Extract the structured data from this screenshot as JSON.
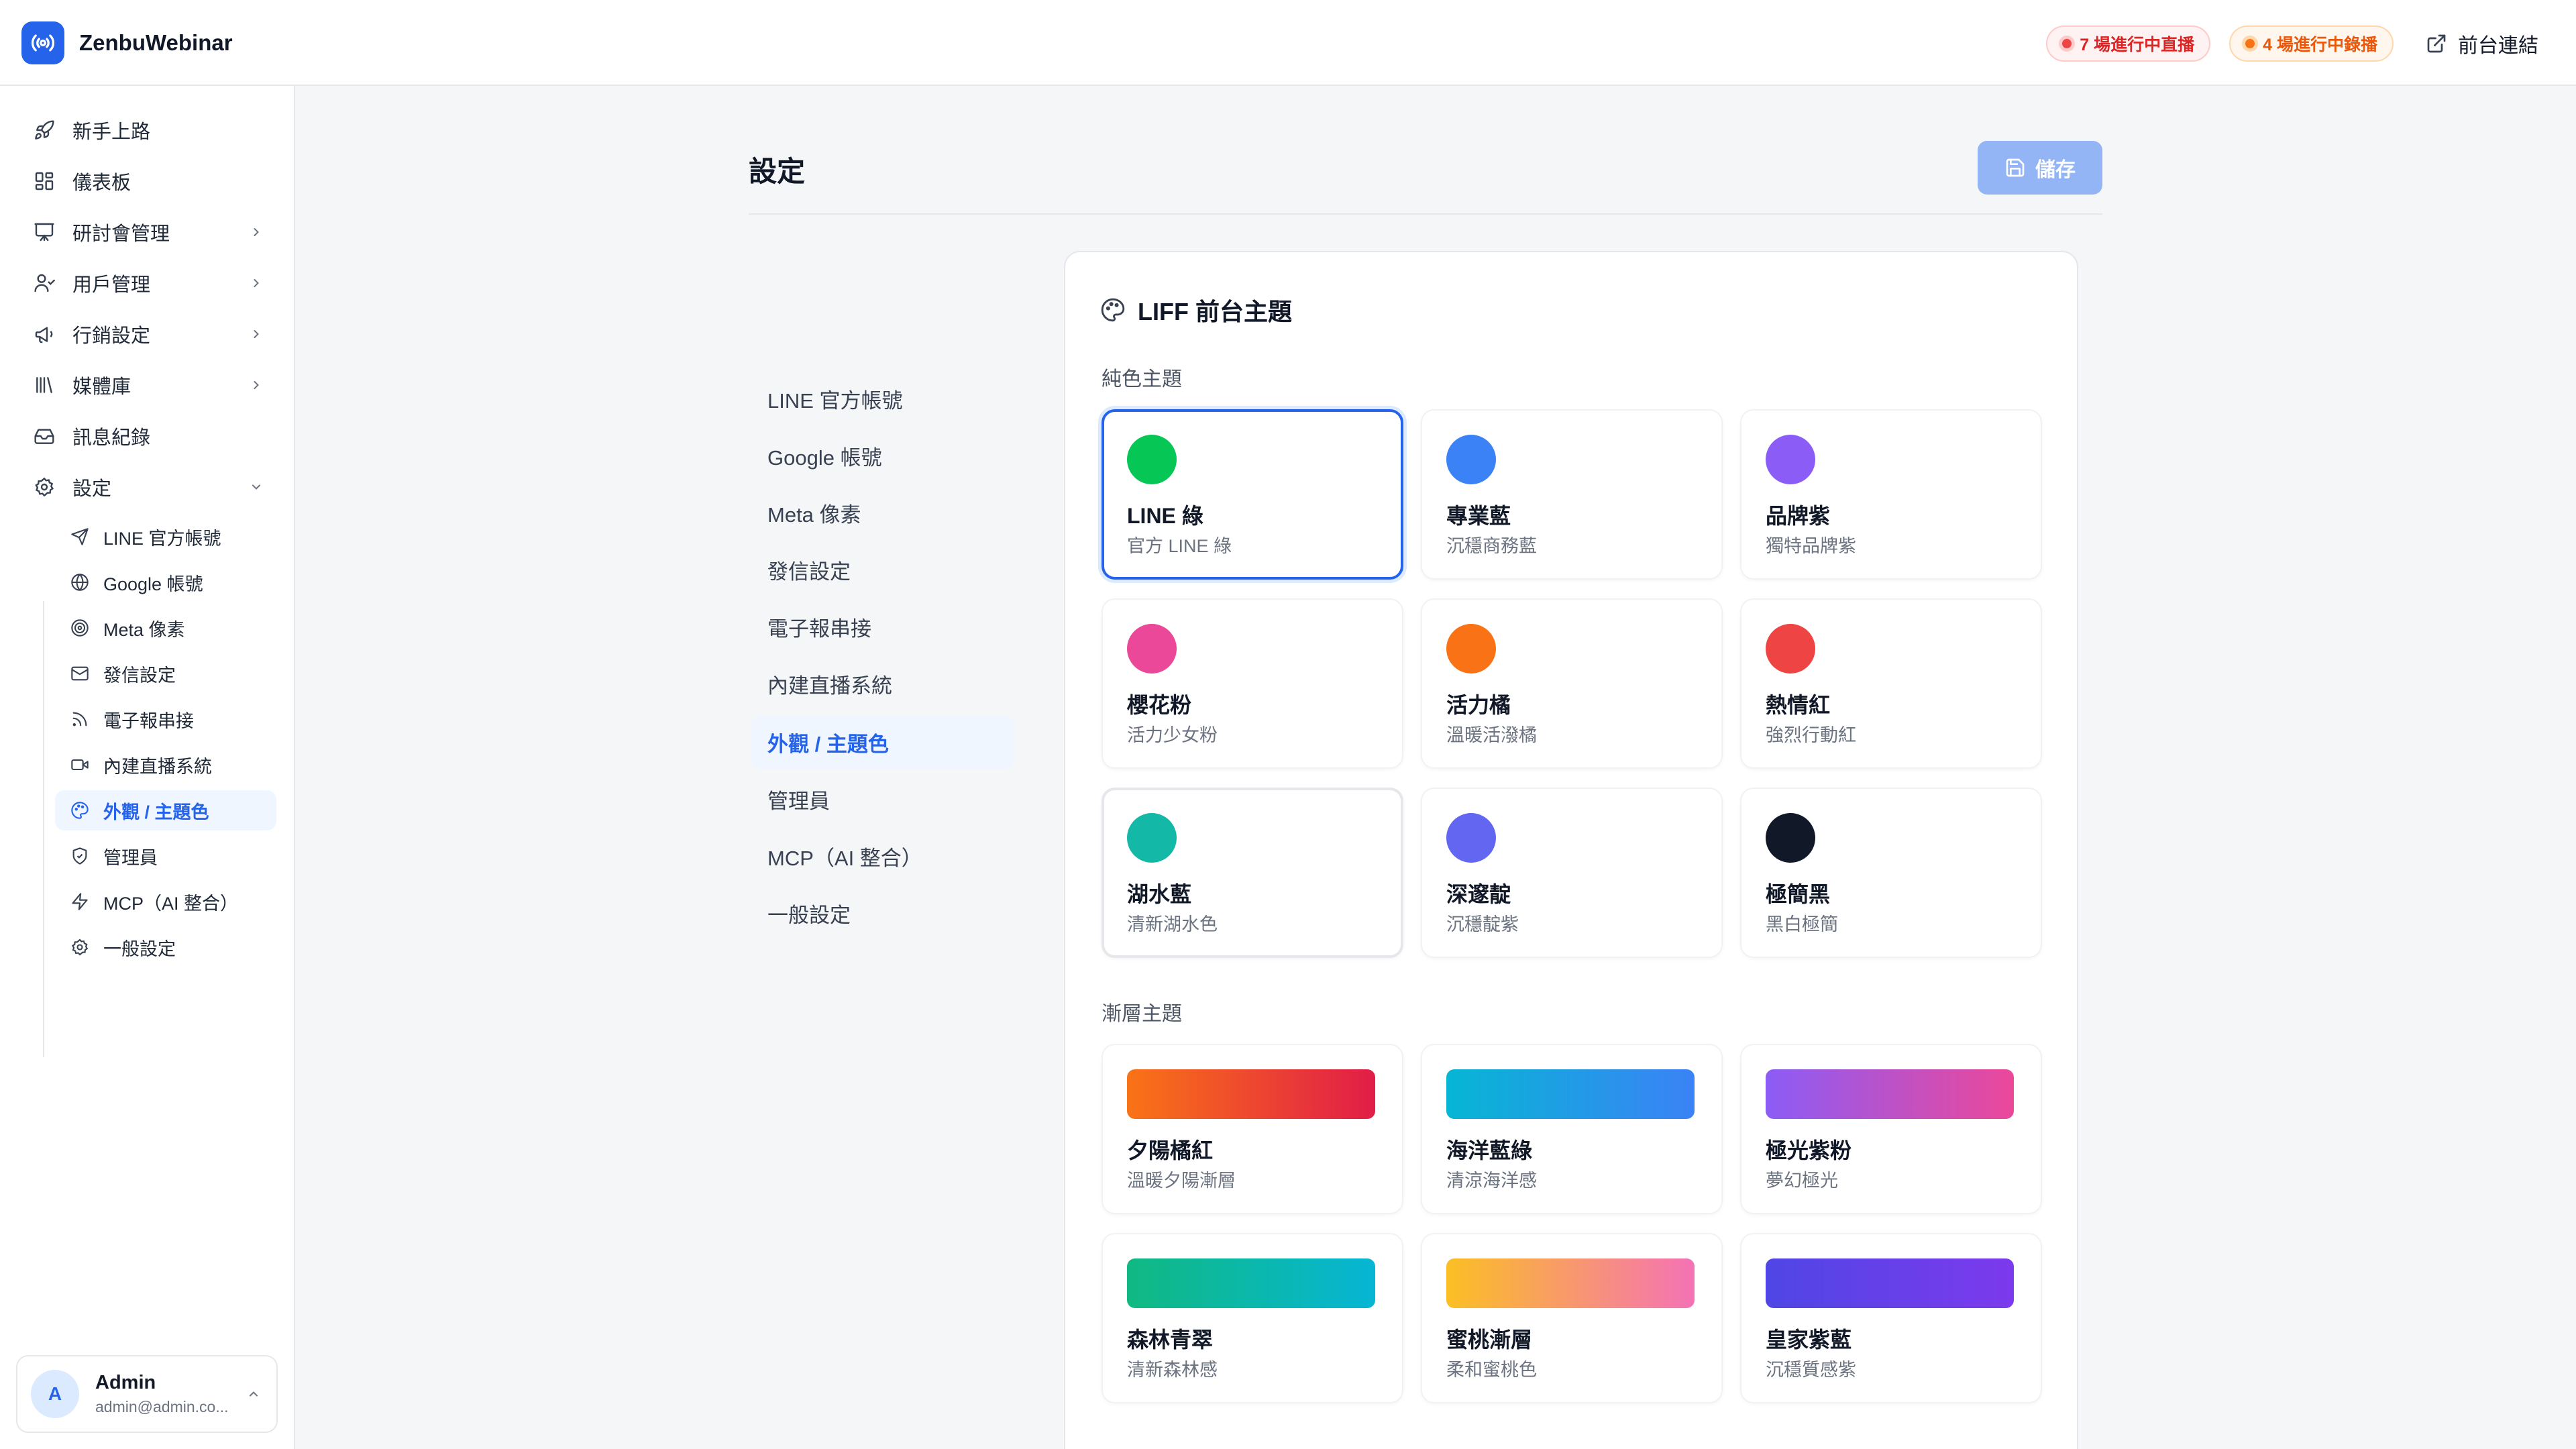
{
  "app": {
    "name": "ZenbuWebinar"
  },
  "header": {
    "live_badge": "7 場進行中直播",
    "record_badge": "4 場進行中錄播",
    "front_link": "前台連結"
  },
  "sidebar": {
    "items": [
      {
        "label": "新手上路",
        "icon": "rocket-icon"
      },
      {
        "label": "儀表板",
        "icon": "dashboard-icon"
      },
      {
        "label": "研討會管理",
        "icon": "presentation-icon"
      },
      {
        "label": "用戶管理",
        "icon": "users-icon"
      },
      {
        "label": "行銷設定",
        "icon": "megaphone-icon"
      },
      {
        "label": "媒體庫",
        "icon": "library-icon"
      },
      {
        "label": "訊息紀錄",
        "icon": "inbox-icon"
      },
      {
        "label": "設定",
        "icon": "gear-icon"
      }
    ],
    "settings_sub": [
      {
        "label": "LINE 官方帳號",
        "icon": "send-icon"
      },
      {
        "label": "Google 帳號",
        "icon": "globe-icon"
      },
      {
        "label": "Meta 像素",
        "icon": "target-icon"
      },
      {
        "label": "發信設定",
        "icon": "mail-icon"
      },
      {
        "label": "電子報串接",
        "icon": "rss-icon"
      },
      {
        "label": "內建直播系統",
        "icon": "video-icon"
      },
      {
        "label": "外觀 / 主題色",
        "icon": "palette-icon"
      },
      {
        "label": "管理員",
        "icon": "shield-icon"
      },
      {
        "label": "MCP（AI 整合）",
        "icon": "bolt-icon"
      },
      {
        "label": "一般設定",
        "icon": "cog-icon"
      }
    ]
  },
  "user": {
    "initial": "A",
    "name": "Admin",
    "email": "admin@admin.co..."
  },
  "page": {
    "title": "設定",
    "save_label": "儲存"
  },
  "settings_nav": [
    "LINE 官方帳號",
    "Google 帳號",
    "Meta 像素",
    "發信設定",
    "電子報串接",
    "內建直播系統",
    "外觀 / 主題色",
    "管理員",
    "MCP（AI 整合）",
    "一般設定"
  ],
  "theme": {
    "title": "LIFF 前台主題",
    "solid_label": "純色主題",
    "gradient_label": "漸層主題",
    "solid": [
      {
        "name": "LINE 綠",
        "desc": "官方 LINE 綠",
        "color": "#06c755"
      },
      {
        "name": "專業藍",
        "desc": "沉穩商務藍",
        "color": "#3b82f6"
      },
      {
        "name": "品牌紫",
        "desc": "獨特品牌紫",
        "color": "#8b5cf6"
      },
      {
        "name": "櫻花粉",
        "desc": "活力少女粉",
        "color": "#ec4899"
      },
      {
        "name": "活力橘",
        "desc": "溫暖活潑橘",
        "color": "#f97316"
      },
      {
        "name": "熱情紅",
        "desc": "強烈行動紅",
        "color": "#ef4444"
      },
      {
        "name": "湖水藍",
        "desc": "清新湖水色",
        "color": "#14b8a6"
      },
      {
        "name": "深邃靛",
        "desc": "沉穩靛紫",
        "color": "#6366f1"
      },
      {
        "name": "極簡黑",
        "desc": "黑白極簡",
        "color": "#111827"
      }
    ],
    "gradient": [
      {
        "name": "夕陽橘紅",
        "desc": "溫暖夕陽漸層",
        "from": "#f97316",
        "to": "#e11d48"
      },
      {
        "name": "海洋藍綠",
        "desc": "清涼海洋感",
        "from": "#06b6d4",
        "to": "#3b82f6"
      },
      {
        "name": "極光紫粉",
        "desc": "夢幻極光",
        "from": "#8b5cf6",
        "to": "#ec4899"
      },
      {
        "name": "森林青翠",
        "desc": "清新森林感",
        "from": "#10b981",
        "to": "#06b6d4"
      },
      {
        "name": "蜜桃漸層",
        "desc": "柔和蜜桃色",
        "from": "#fbbf24",
        "to": "#f472b6"
      },
      {
        "name": "皇家紫藍",
        "desc": "沉穩質感紫",
        "from": "#4f46e5",
        "to": "#7c3aed"
      }
    ],
    "selected": "LINE 綠"
  }
}
